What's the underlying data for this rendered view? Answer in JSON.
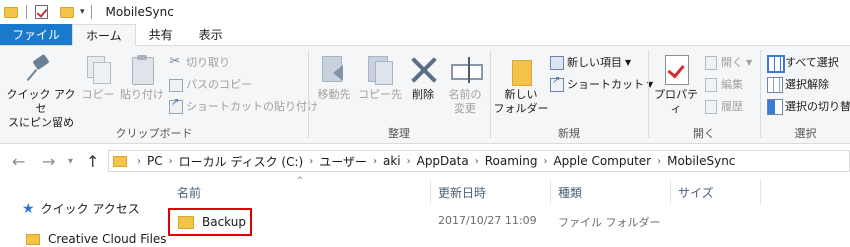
{
  "window": {
    "title": "MobileSync"
  },
  "tabs": [
    "ファイル",
    "ホーム",
    "共有",
    "表示"
  ],
  "ribbon": {
    "clipboard": {
      "pin_label_1": "クイック アクセ",
      "pin_label_2": "スにピン留め",
      "copy_label": "コピー",
      "paste_label": "貼り付け",
      "cut_label": "切り取り",
      "copy_path_label": "パスのコピー",
      "paste_shortcut_label": "ショートカットの貼り付け",
      "group_label": "クリップボード"
    },
    "organize": {
      "move_label": "移動先",
      "copyto_label": "コピー先",
      "delete_label": "削除",
      "rename_label_1": "名前の",
      "rename_label_2": "変更",
      "group_label": "整理"
    },
    "new": {
      "new_folder_label_1": "新しい",
      "new_folder_label_2": "フォルダー",
      "new_item_label": "新しい項目",
      "shortcut_label": "ショートカット",
      "group_label": "新規"
    },
    "open": {
      "properties_label": "プロパティ",
      "open_label": "開く",
      "edit_label": "編集",
      "history_label": "履歴",
      "group_label": "開く"
    },
    "select": {
      "select_all_label": "すべて選択",
      "select_none_label": "選択解除",
      "invert_label": "選択の切り替",
      "group_label": "選択"
    }
  },
  "address": {
    "crumbs": [
      "PC",
      "ローカル ディスク (C:)",
      "ユーザー",
      "aki",
      "AppData",
      "Roaming",
      "Apple Computer",
      "MobileSync"
    ]
  },
  "columns": {
    "name": "名前",
    "modified": "更新日時",
    "type": "種類",
    "size": "サイズ"
  },
  "nav_pane": {
    "quick_access": "クイック アクセス",
    "creative_cloud": "Creative Cloud Files"
  },
  "files": [
    {
      "name": "Backup",
      "modified": "2017/10/27 11:09",
      "type": "ファイル フォルダー"
    }
  ],
  "colors": {
    "file_tab": "#1979ca",
    "highlight_border": "#e00000",
    "folder": "#f4c44a"
  }
}
